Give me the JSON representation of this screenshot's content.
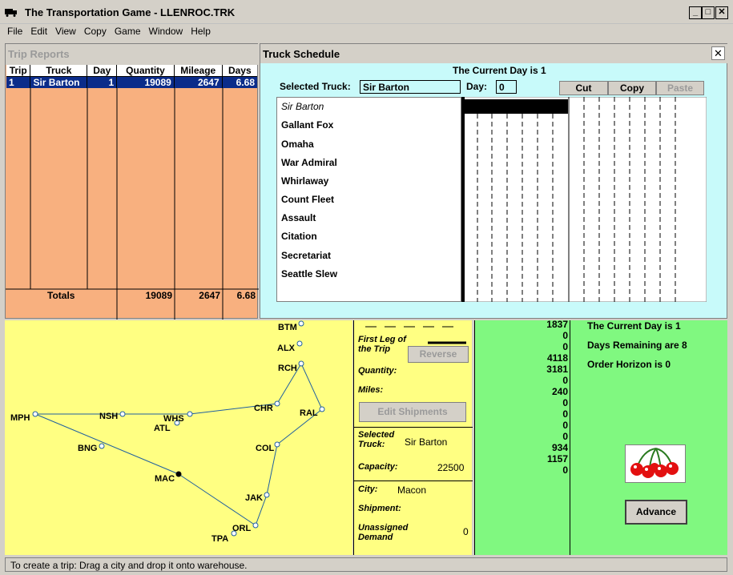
{
  "window": {
    "title": "The Transportation Game - LLENROC.TRK",
    "minimize": "_",
    "maximize": "□",
    "close": "✕"
  },
  "menu": [
    "File",
    "Edit",
    "View",
    "Copy",
    "Game",
    "Window",
    "Help"
  ],
  "trip_reports": {
    "title": "Trip Reports",
    "columns": [
      "Trip",
      "Truck",
      "Day",
      "Quantity",
      "Mileage",
      "Days"
    ],
    "rows": [
      {
        "trip": "1",
        "truck": "Sir Barton",
        "day": "1",
        "quantity": "19089",
        "mileage": "2647",
        "days": "6.68"
      }
    ],
    "totals": {
      "label": "Totals",
      "quantity": "19089",
      "mileage": "2647",
      "days": "6.68"
    }
  },
  "schedule": {
    "title": "Truck Schedule",
    "close": "✕",
    "current_day": "The Current Day is 1",
    "selected_truck_label": "Selected Truck:",
    "selected_truck": "Sir Barton",
    "day_label": "Day:",
    "day": "0",
    "cut": "Cut",
    "copy": "Copy",
    "paste": "Paste",
    "trucks": [
      "Sir Barton",
      "Gallant Fox",
      "Omaha",
      "War Admiral",
      "Whirlaway",
      "Count Fleet",
      "Assault",
      "Citation",
      "Secretariat",
      "Seattle Slew"
    ]
  },
  "map": {
    "cities": {
      "BTM": "BTM",
      "ALX": "ALX",
      "RCH": "RCH",
      "CHR": "CHR",
      "RAL": "RAL",
      "MPH": "MPH",
      "NSH": "NSH",
      "WHS": "WHS",
      "ATL": "ATL",
      "BNG": "BNG",
      "COL": "COL",
      "MAC": "MAC",
      "JAK": "JAK",
      "ORL": "ORL",
      "TPA": "TPA"
    }
  },
  "info": {
    "first_leg": "First Leg of the Trip",
    "reverse": "Reverse",
    "quantity": "Quantity:",
    "miles": "Miles:",
    "edit_shipments": "Edit Shipments",
    "selected_truck_label": "Selected Truck:",
    "selected_truck": "Sir Barton",
    "capacity_label": "Capacity:",
    "capacity": "22500",
    "city_label": "City:",
    "city": "Macon",
    "shipment_label": "Shipment:",
    "unassigned_label": "Unassigned Demand",
    "unassigned": "0"
  },
  "status_panel": {
    "numbers": [
      "1837",
      "0",
      "0",
      "4118",
      "3181",
      "0",
      "240",
      "0",
      "0",
      "0",
      "0",
      "934",
      "1157",
      "0"
    ],
    "current_day": "The Current Day is 1",
    "days_remaining": "Days Remaining are 8",
    "order_horizon": "Order Horizon is 0",
    "advance": "Advance",
    "icon": "cherries-icon"
  },
  "statusbar": "To create a trip: Drag a city and drop it onto warehouse."
}
